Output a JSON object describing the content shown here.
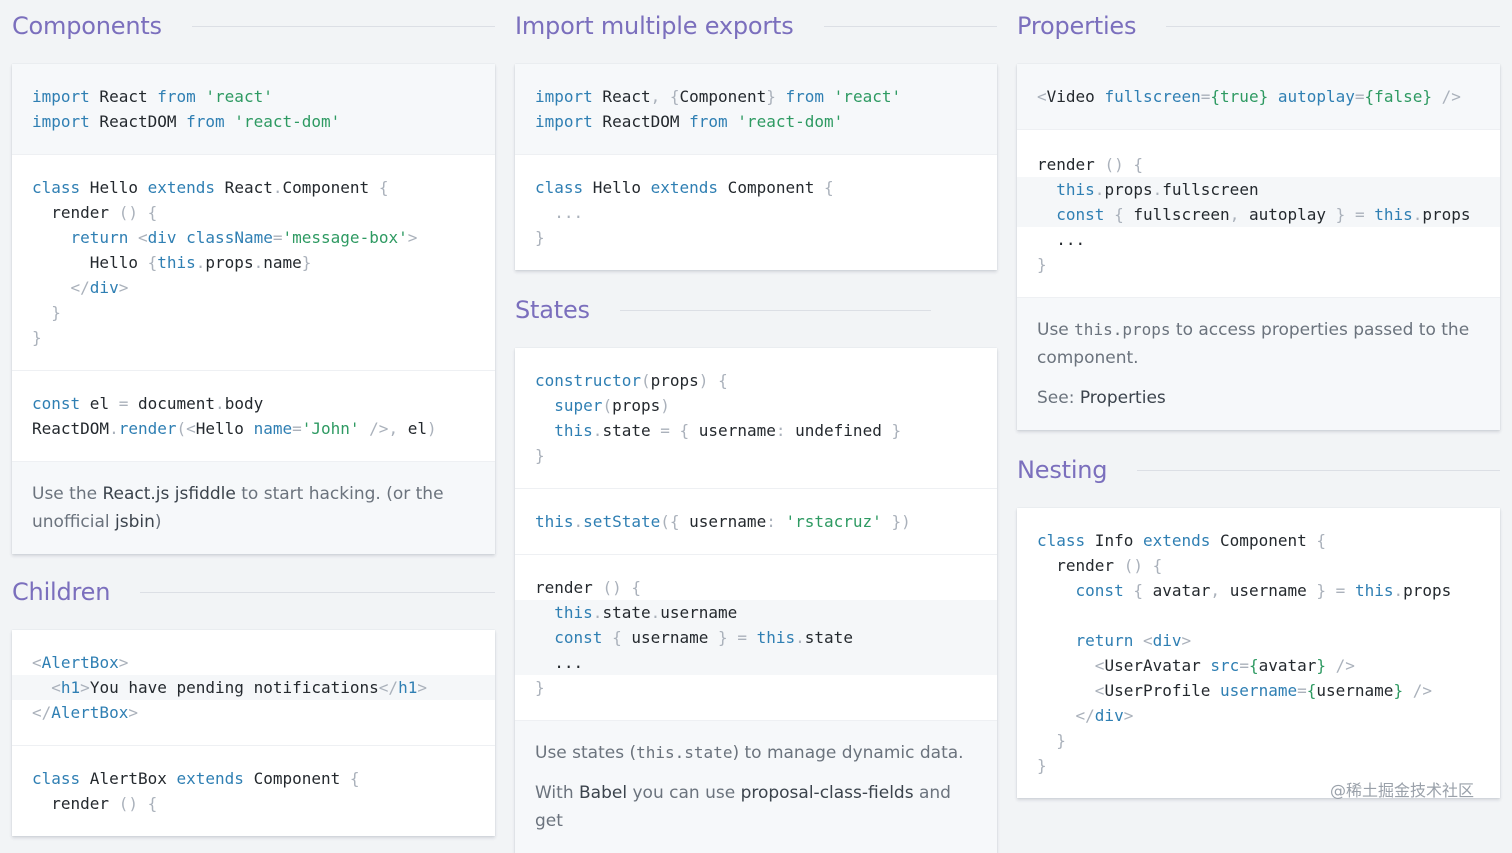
{
  "sections": {
    "components": {
      "title": "Components"
    },
    "children": {
      "title": "Children"
    },
    "import_multiple": {
      "title": "Import multiple exports"
    },
    "states": {
      "title": "States"
    },
    "properties": {
      "title": "Properties"
    },
    "nesting": {
      "title": "Nesting"
    }
  },
  "components_note": {
    "before": "Use the ",
    "link1": "React.js jsfiddle",
    "middle": " to start hacking. (or the unofficial ",
    "link2": "jsbin",
    "after": ")"
  },
  "states_note": {
    "line1_before": "Use states (",
    "line1_code": "this.state",
    "line1_after": ") to manage dynamic data.",
    "line2_before": "With ",
    "line2_link1": "Babel",
    "line2_middle": " you can use ",
    "line2_link2": "proposal-class-fields",
    "line2_after": " and get"
  },
  "properties_note": {
    "line1_before": "Use ",
    "line1_code": "this.props",
    "line1_after": " to access properties passed to the component.",
    "see_label": "See: ",
    "see_link": "Properties"
  },
  "watermark": "@稀土掘金技术社区"
}
